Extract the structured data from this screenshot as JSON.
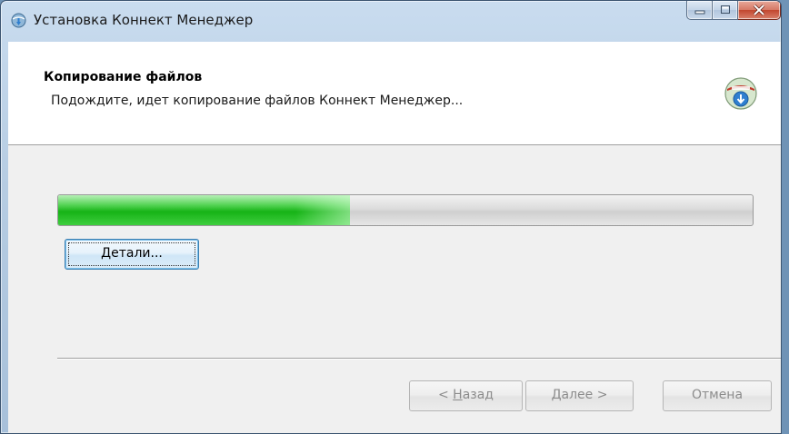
{
  "window": {
    "title": "Установка Коннект Менеджер"
  },
  "header": {
    "title": "Копирование файлов",
    "subtitle": "Подождите, идет копирование файлов Коннект Менеджер..."
  },
  "progress": {
    "value_percent": 42
  },
  "buttons": {
    "details_underlined": "Д",
    "details_rest": "етали...",
    "back_prefix": "< ",
    "back_underlined": "Н",
    "back_rest": "азад",
    "next_underlined": "Д",
    "next_rest": "алее >",
    "cancel": "Отмена"
  },
  "icons": {
    "app": "installer-globe-icon",
    "header": "install-download-icon",
    "minimize": "minimize-icon",
    "maximize": "maximize-icon",
    "close": "close-icon"
  },
  "colors": {
    "progress_fill": "#16b316",
    "close_button": "#c2472f",
    "header_bg": "#ffffff",
    "body_bg": "#f0f0f0"
  }
}
